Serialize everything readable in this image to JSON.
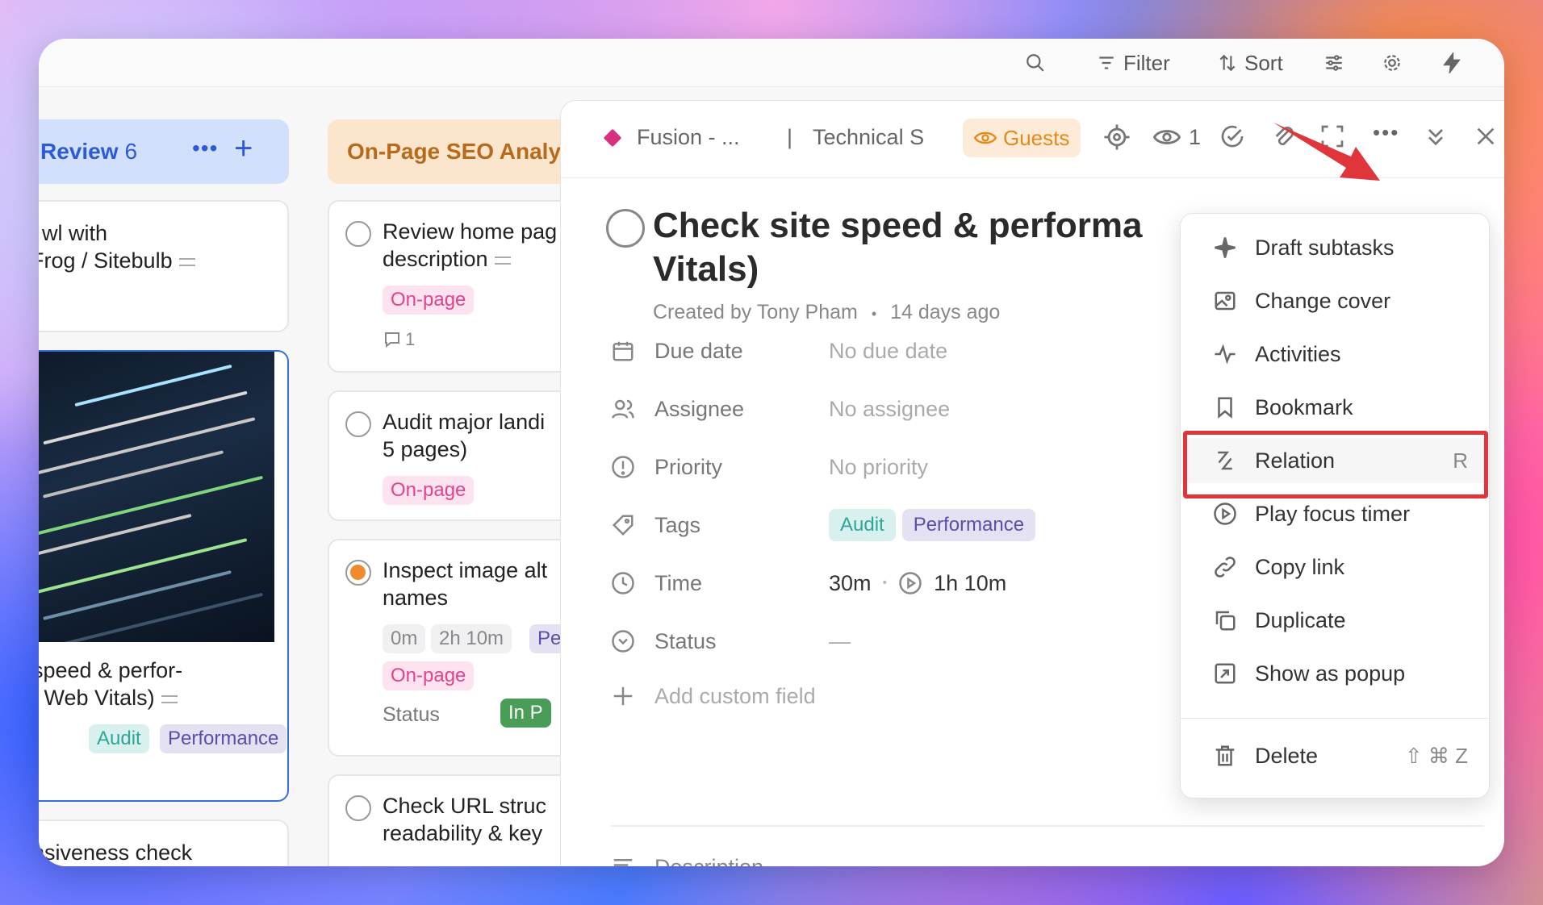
{
  "topbar": {
    "filter_label": "Filter",
    "sort_label": "Sort"
  },
  "board": {
    "review_column": {
      "title": "Review",
      "count": "6"
    },
    "onpage_column": {
      "title": "On-Page SEO Analy"
    },
    "review_cards": [
      {
        "line1": "wl with",
        "line2": "Frog / Sitebulb"
      },
      {
        "line1": "speed & perfor-",
        "line2": "e Web Vitals)",
        "tags": [
          "Audit",
          "Performance"
        ]
      },
      {
        "line1": "nsiveness check"
      }
    ],
    "onpage_cards": [
      {
        "line1": "Review home pag",
        "line2": "description",
        "tag": "On-page",
        "comments": "1"
      },
      {
        "line1": "Audit major landi",
        "line2": "5 pages)",
        "tag": "On-page"
      },
      {
        "line1": "Inspect image alt",
        "line2": "names",
        "time_a": "0m",
        "time_b": "2h 10m",
        "tag_perf": "Perf",
        "tag": "On-page",
        "status_label": "Status",
        "status_value": "In P"
      },
      {
        "line1": "Check URL struc",
        "line2": "readability & key"
      }
    ]
  },
  "panel": {
    "breadcrumb_project": "Fusion - ...",
    "breadcrumb_separator": "|",
    "breadcrumb_list": "Technical S",
    "guests_label": "Guests",
    "watchers_count": "1",
    "title": "Check site speed & performa... Vitals)",
    "title_line1": "Check site speed & performa",
    "title_line2": "Vitals)",
    "created_by": "Created by Tony Pham",
    "meta_dot": "•",
    "created_ago": "14 days ago",
    "fields": {
      "due_date": {
        "label": "Due date",
        "value": "No due date"
      },
      "assignee": {
        "label": "Assignee",
        "value": "No assignee"
      },
      "priority": {
        "label": "Priority",
        "value": "No priority"
      },
      "tags": {
        "label": "Tags",
        "values": [
          "Audit",
          "Performance"
        ]
      },
      "time": {
        "label": "Time",
        "estimate": "30m",
        "dot": "•",
        "tracked": "1h 10m"
      },
      "status": {
        "label": "Status",
        "value": "—"
      },
      "add_custom": "Add custom field"
    },
    "description_label": "Description"
  },
  "menu": {
    "items": [
      {
        "label": "Draft subtasks",
        "icon": "sparkle-icon"
      },
      {
        "label": "Change cover",
        "icon": "image-icon"
      },
      {
        "label": "Activities",
        "icon": "activity-icon"
      },
      {
        "label": "Bookmark",
        "icon": "bookmark-icon"
      },
      {
        "label": "Relation",
        "icon": "relation-icon",
        "shortcut": "R"
      },
      {
        "label": "Play focus timer",
        "icon": "play-circle-icon"
      },
      {
        "label": "Copy link",
        "icon": "link-icon"
      },
      {
        "label": "Duplicate",
        "icon": "duplicate-icon"
      },
      {
        "label": "Show as popup",
        "icon": "popup-icon"
      },
      {
        "label": "Delete",
        "icon": "trash-icon",
        "shortcut": "⇧ ⌘ Z"
      }
    ]
  },
  "colors": {
    "accent_blue": "#2d5bd7",
    "highlight_red": "#e0353b",
    "onpage_pink": "#e0448c",
    "guests_orange": "#e48a1c"
  }
}
